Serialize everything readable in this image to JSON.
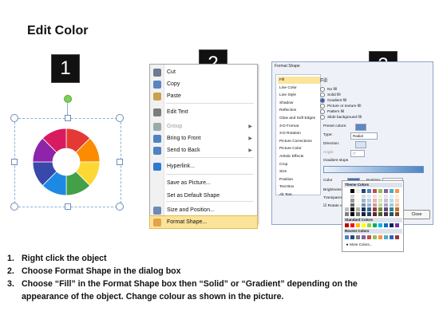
{
  "page": {
    "title": "Edit Color",
    "steps": [
      "1",
      "2",
      "3"
    ]
  },
  "context_menu": {
    "items": [
      {
        "label": "Cut",
        "icon": "scissors-icon",
        "enabled": true,
        "submenu": false
      },
      {
        "label": "Copy",
        "icon": "copy-icon",
        "enabled": true,
        "submenu": false
      },
      {
        "label": "Paste",
        "icon": "paste-icon",
        "enabled": true,
        "submenu": false
      },
      {
        "label": "Edit Text",
        "icon": "edit-text-icon",
        "enabled": true,
        "submenu": false
      },
      {
        "label": "Group",
        "icon": "group-icon",
        "enabled": false,
        "submenu": true
      },
      {
        "label": "Bring to Front",
        "icon": "bring-front-icon",
        "enabled": true,
        "submenu": true
      },
      {
        "label": "Send to Back",
        "icon": "send-back-icon",
        "enabled": true,
        "submenu": true
      },
      {
        "label": "Hyperlink...",
        "icon": "hyperlink-icon",
        "enabled": true,
        "submenu": false
      },
      {
        "label": "Save as Picture...",
        "icon": "",
        "enabled": true,
        "submenu": false
      },
      {
        "label": "Set as Default Shape",
        "icon": "",
        "enabled": true,
        "submenu": false
      },
      {
        "label": "Size and Position...",
        "icon": "size-position-icon",
        "enabled": true,
        "submenu": false
      },
      {
        "label": "Format Shape...",
        "icon": "format-shape-icon",
        "enabled": true,
        "submenu": false,
        "highlighted": true
      }
    ]
  },
  "format_dialog": {
    "title": "Format Shape",
    "categories": [
      "Fill",
      "Line Color",
      "Line Style",
      "Shadow",
      "Reflection",
      "Glow and Soft Edges",
      "3-D Format",
      "3-D Rotation",
      "Picture Corrections",
      "Picture Color",
      "Artistic Effects",
      "Crop",
      "Size",
      "Position",
      "Text Box",
      "Alt Text"
    ],
    "selected_category": "Fill",
    "section_header": "Fill",
    "fill_options": [
      {
        "label": "No fill",
        "selected": false
      },
      {
        "label": "Solid fill",
        "selected": false
      },
      {
        "label": "Gradient fill",
        "selected": true
      },
      {
        "label": "Picture or texture fill",
        "selected": false
      },
      {
        "label": "Pattern fill",
        "selected": false
      },
      {
        "label": "Slide background fill",
        "selected": false
      }
    ],
    "preset_colors_label": "Preset colors:",
    "type_label": "Type:",
    "type_value": "Radial",
    "direction_label": "Direction:",
    "angle_label": "Angle:",
    "angle_value": "0°",
    "gradient_stops_label": "Gradient stops",
    "color_label": "Color",
    "position_label": "Position:",
    "position_value": "0%",
    "brightness_label": "Brightness",
    "transparency_label": "Transparen",
    "rotate_label": "Rotate w",
    "close_label": "Close"
  },
  "color_palette": {
    "theme_header": "Theme Colors",
    "standard_header": "Standard Colors",
    "recent_header": "Recent Colors",
    "more_label": "More Colors...",
    "theme_top": [
      "#ffffff",
      "#000000",
      "#eeece1",
      "#1f497d",
      "#4f81bd",
      "#c0504d",
      "#9bbb59",
      "#8064a2",
      "#4bacc6",
      "#f79646"
    ],
    "standard": [
      "#c00000",
      "#ff0000",
      "#ffc000",
      "#ffff00",
      "#92d050",
      "#00b050",
      "#00b0f0",
      "#0070c0",
      "#002060",
      "#7030a0"
    ],
    "recent": [
      "#4f81bd",
      "#1f497d",
      "#7f7f7f",
      "#8064a2",
      "#c0504d",
      "#9bbb59",
      "#f79646",
      "#4bacc6",
      "#2b63b8",
      "#953734"
    ]
  },
  "instructions": [
    {
      "num": "1.",
      "text": "Right click the object"
    },
    {
      "num": "2.",
      "text": "Choose Format Shape in the dialog box"
    },
    {
      "num": "3.",
      "text": "Choose “Fill” in the Format Shape box then “Solid” or “Gradient” depending on the"
    },
    {
      "num": "",
      "text": "appearance of the object. Change colour as shown in the picture."
    }
  ],
  "puzzle_colors": [
    "#e53935",
    "#fb8c00",
    "#fdd835",
    "#43a047",
    "#1e88e5",
    "#3949ab",
    "#8e24aa",
    "#d81b60"
  ]
}
